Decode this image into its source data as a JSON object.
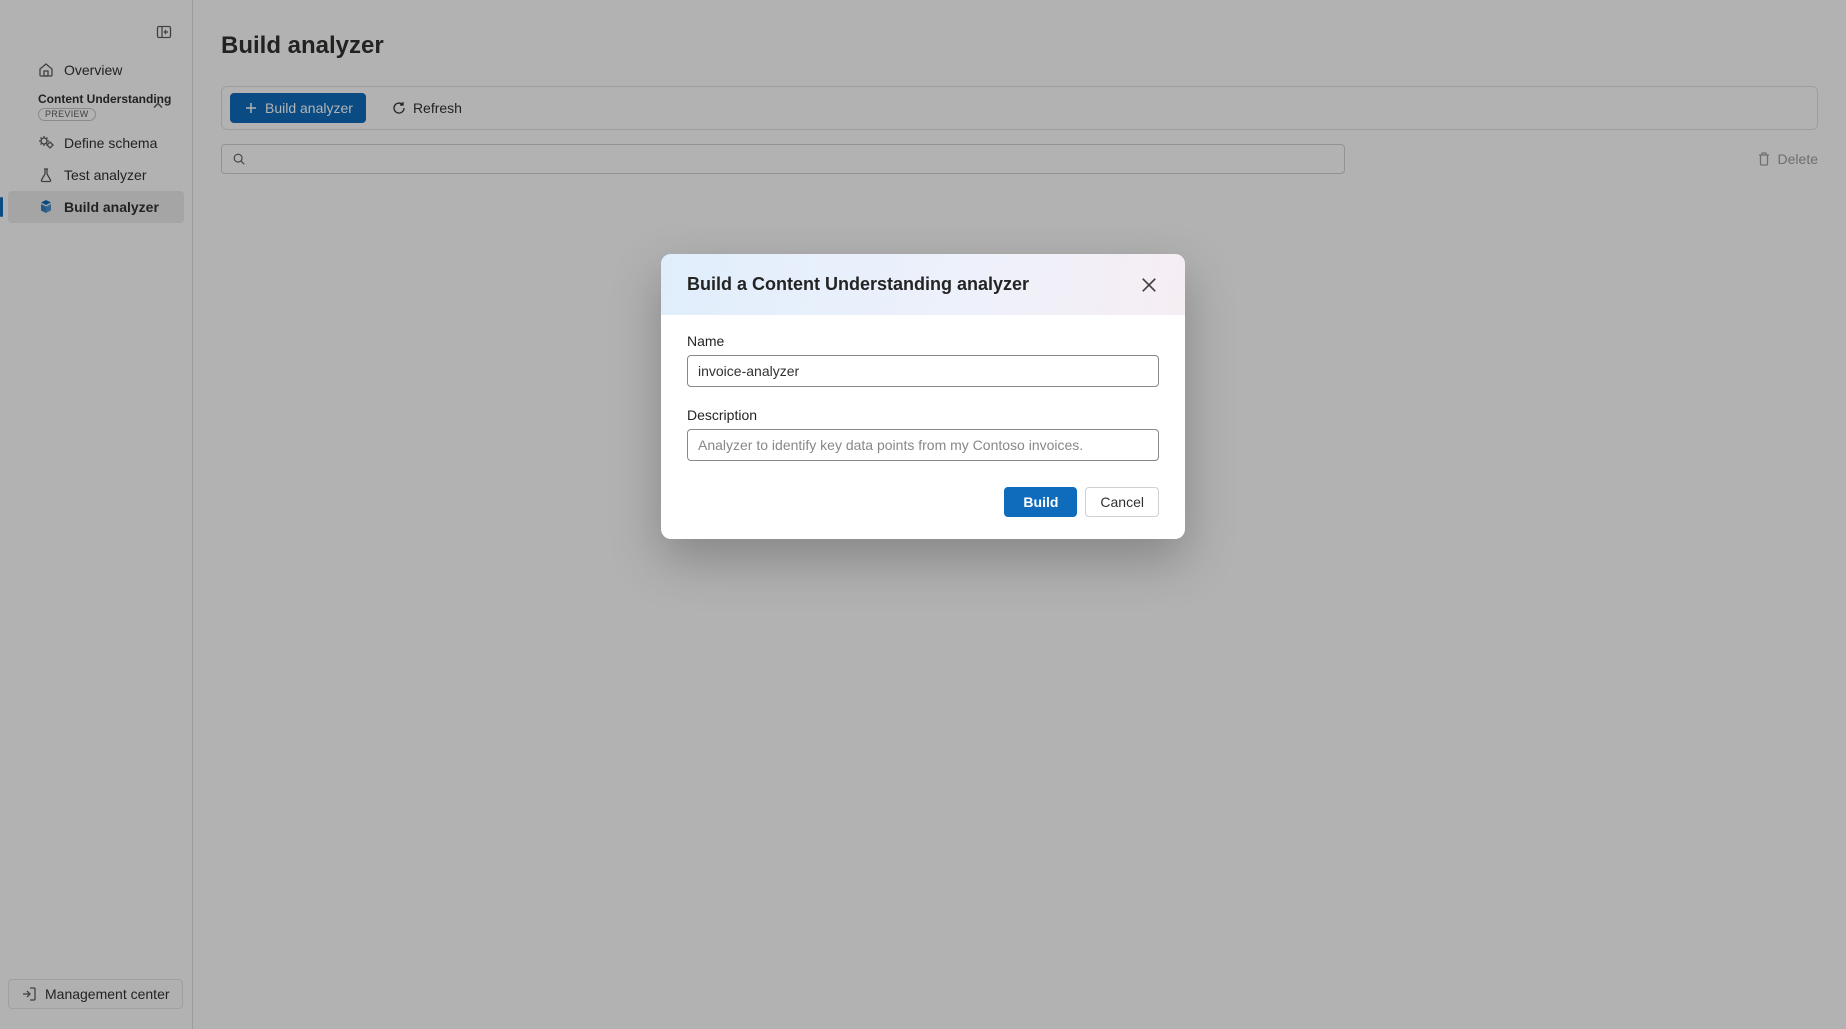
{
  "sidebar": {
    "overview_label": "Overview",
    "group": {
      "title": "Content Understanding",
      "preview_badge": "PREVIEW"
    },
    "items": {
      "define_schema": "Define schema",
      "test_analyzer": "Test analyzer",
      "build_analyzer": "Build analyzer"
    },
    "management_center": "Management center"
  },
  "page": {
    "title": "Build analyzer"
  },
  "toolbar": {
    "build_label": "Build analyzer",
    "refresh_label": "Refresh",
    "delete_label": "Delete",
    "search_placeholder": ""
  },
  "dialog": {
    "title": "Build a Content Understanding analyzer",
    "name_label": "Name",
    "name_value": "invoice-analyzer",
    "description_label": "Description",
    "description_placeholder": "Analyzer to identify key data points from my Contoso invoices.",
    "description_value": "",
    "build_label": "Build",
    "cancel_label": "Cancel"
  }
}
